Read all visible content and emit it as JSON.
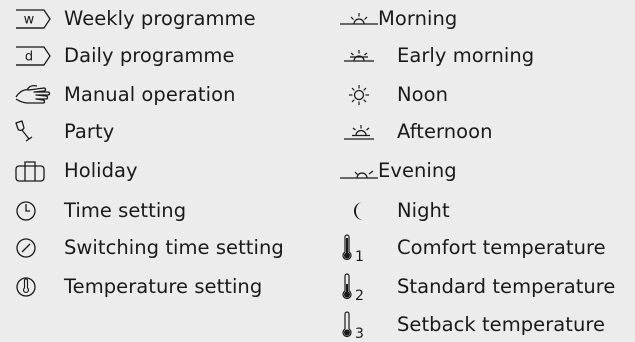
{
  "left_column": [
    {
      "icon": "weekly-program-icon",
      "icon_text": "w",
      "label": "Weekly programme"
    },
    {
      "icon": "daily-program-icon",
      "icon_text": "d",
      "label": "Daily programme"
    },
    {
      "icon": "manual-hand-icon",
      "label": "Manual operation"
    },
    {
      "icon": "party-glass-icon",
      "label": "Party"
    },
    {
      "icon": "holiday-suitcase-icon",
      "label": "Holiday"
    },
    {
      "icon": "clock-icon",
      "label": "Time setting"
    },
    {
      "icon": "switching-time-icon",
      "label": "Switching time setting"
    },
    {
      "icon": "thermometer-dial-icon",
      "label": "Temperature setting"
    }
  ],
  "right_column": [
    {
      "icon": "morning-sun-icon",
      "label": "Morning"
    },
    {
      "icon": "early-morning-sun-icon",
      "label": "Early morning"
    },
    {
      "icon": "noon-sun-icon",
      "label": "Noon"
    },
    {
      "icon": "afternoon-sun-icon",
      "label": "Afternoon"
    },
    {
      "icon": "evening-sun-icon",
      "label": "Evening"
    },
    {
      "icon": "night-moon-icon",
      "label": "Night"
    },
    {
      "icon": "comfort-thermometer-icon",
      "subscript": "1",
      "label": "Comfort temperature"
    },
    {
      "icon": "standard-thermometer-icon",
      "subscript": "2",
      "label": "Standard temperature"
    },
    {
      "icon": "setback-thermometer-icon",
      "subscript": "3",
      "label": "Setback temperature"
    }
  ],
  "colors": {
    "background": "#ececec",
    "text": "#1a1a1a"
  }
}
